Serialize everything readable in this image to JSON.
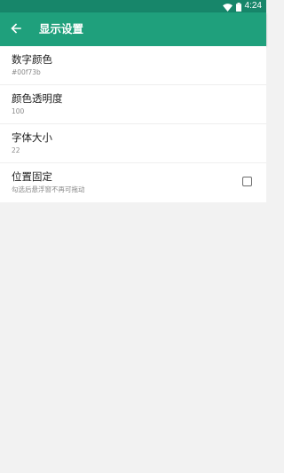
{
  "status_bar": {
    "time": "4:24",
    "icons": [
      "wifi-icon",
      "battery-icon"
    ],
    "color": "#17866a"
  },
  "app_bar": {
    "title": "显示设置",
    "back_icon": "arrow-left-icon",
    "color": "#1fa07c"
  },
  "settings": [
    {
      "title": "数字颜色",
      "summary": "#00f73b"
    },
    {
      "title": "颜色透明度",
      "summary": "100"
    },
    {
      "title": "字体大小",
      "summary": "22"
    },
    {
      "title": "位置固定",
      "summary": "勾选后悬浮窗不再可拖动",
      "checked": false
    }
  ]
}
